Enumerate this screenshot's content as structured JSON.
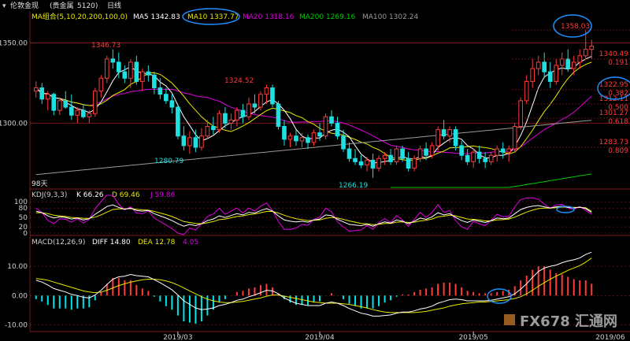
{
  "title": {
    "name": "伦敦金现",
    "category": "(贵金属",
    "code": "5120)",
    "period": "日线"
  },
  "colors": {
    "up": "#ff3b3b",
    "down": "#1ee0e0",
    "grid": "#7a1a1a",
    "ma5": "#ffffff",
    "ma10": "#e8e800",
    "ma20": "#e000e0",
    "ma200": "#00c800",
    "ma100": "#9a9a9a",
    "ann": "#1e90ff",
    "neg": "#00e5e5",
    "axis": "#d0d0d0"
  },
  "legend_main": {
    "label": "MA组合(5,10,20,200,100,0)",
    "ma5": "MA5 1342.83",
    "ma10": "MA10 1337.77",
    "ma20": "MA20 1318.16",
    "ma200": "MA200 1269.16",
    "ma100": "MA100 1302.24"
  },
  "legend_kdj": {
    "label": "KDJ(9,3,3)",
    "k": "K 66.26",
    "d": "D 69.46",
    "j": "J 59.86"
  },
  "legend_macd": {
    "label": "MACD(12,26,9)",
    "diff": "DIFF 14.80",
    "dea": "DEA 12.78",
    "macd": "4.05"
  },
  "days_label": "98天",
  "watermark": "FX678 汇通网",
  "price_labels": {
    "high1": "1346.73",
    "high2": "1324.52",
    "low1": "1280.79",
    "low2": "1266.19",
    "last_high": "1358.03"
  },
  "fib_levels": [
    {
      "price": "1340.49",
      "ratio": "0.191"
    },
    {
      "price": "1322.95",
      "ratio": "0.382"
    },
    {
      "price": "1312.11",
      "ratio": "0.500"
    },
    {
      "price": "1301.27",
      "ratio": "0.618"
    },
    {
      "price": "1283.73",
      "ratio": "0.809"
    }
  ],
  "chart_data": {
    "type": "candlestick",
    "price_axis": {
      "ticks": [
        1350.0,
        1300.0
      ],
      "ylim": [
        1260,
        1362
      ]
    },
    "kdj_axis": {
      "ticks": [
        100,
        80,
        50,
        20,
        0
      ],
      "ylim": [
        -5,
        108
      ]
    },
    "macd_axis": {
      "ticks": [
        10.0,
        0.0,
        -10.0
      ],
      "ylim": [
        -12,
        17
      ]
    },
    "x_ticks": [
      "2019/03",
      "2019/04",
      "2019/05",
      "2019/06"
    ],
    "x_tick_index": [
      24,
      48,
      74,
      111
    ],
    "candles": [
      [
        1320,
        1326,
        1316,
        1322
      ],
      [
        1322,
        1325,
        1312,
        1315
      ],
      [
        1315,
        1320,
        1308,
        1318
      ],
      [
        1318,
        1319,
        1305,
        1308
      ],
      [
        1308,
        1316,
        1305,
        1314
      ],
      [
        1314,
        1320,
        1309,
        1310
      ],
      [
        1310,
        1318,
        1302,
        1305
      ],
      [
        1305,
        1310,
        1300,
        1308
      ],
      [
        1308,
        1312,
        1303,
        1304
      ],
      [
        1304,
        1308,
        1300,
        1306
      ],
      [
        1306,
        1322,
        1304,
        1320
      ],
      [
        1320,
        1330,
        1316,
        1328
      ],
      [
        1328,
        1342,
        1325,
        1340
      ],
      [
        1340,
        1346,
        1334,
        1338
      ],
      [
        1338,
        1344,
        1328,
        1332
      ],
      [
        1332,
        1336,
        1325,
        1328
      ],
      [
        1328,
        1340,
        1322,
        1338
      ],
      [
        1338,
        1342,
        1324,
        1326
      ],
      [
        1326,
        1334,
        1320,
        1332
      ],
      [
        1332,
        1336,
        1326,
        1330
      ],
      [
        1330,
        1332,
        1318,
        1322
      ],
      [
        1322,
        1328,
        1315,
        1318
      ],
      [
        1318,
        1322,
        1312,
        1314
      ],
      [
        1314,
        1318,
        1306,
        1310
      ],
      [
        1310,
        1312,
        1290,
        1292
      ],
      [
        1292,
        1298,
        1283,
        1286
      ],
      [
        1286,
        1295,
        1281,
        1291
      ],
      [
        1291,
        1296,
        1282,
        1285
      ],
      [
        1285,
        1297,
        1283,
        1292
      ],
      [
        1292,
        1302,
        1290,
        1298
      ],
      [
        1298,
        1304,
        1293,
        1296
      ],
      [
        1296,
        1308,
        1294,
        1306
      ],
      [
        1306,
        1310,
        1297,
        1300
      ],
      [
        1300,
        1306,
        1296,
        1302
      ],
      [
        1302,
        1310,
        1298,
        1308
      ],
      [
        1308,
        1312,
        1300,
        1304
      ],
      [
        1304,
        1316,
        1302,
        1312
      ],
      [
        1312,
        1318,
        1306,
        1310
      ],
      [
        1310,
        1320,
        1308,
        1318
      ],
      [
        1318,
        1324,
        1312,
        1322
      ],
      [
        1322,
        1324,
        1310,
        1312
      ],
      [
        1312,
        1314,
        1296,
        1298
      ],
      [
        1298,
        1302,
        1286,
        1290
      ],
      [
        1290,
        1294,
        1285,
        1292
      ],
      [
        1292,
        1296,
        1286,
        1289
      ],
      [
        1289,
        1294,
        1285,
        1291
      ],
      [
        1291,
        1293,
        1284,
        1288
      ],
      [
        1288,
        1296,
        1286,
        1294
      ],
      [
        1294,
        1300,
        1289,
        1292
      ],
      [
        1292,
        1306,
        1290,
        1304
      ],
      [
        1304,
        1308,
        1298,
        1300
      ],
      [
        1300,
        1304,
        1290,
        1292
      ],
      [
        1292,
        1296,
        1282,
        1284
      ],
      [
        1284,
        1288,
        1276,
        1278
      ],
      [
        1278,
        1284,
        1274,
        1276
      ],
      [
        1276,
        1280,
        1272,
        1274
      ],
      [
        1274,
        1279,
        1270,
        1277
      ],
      [
        1277,
        1281,
        1266,
        1272
      ],
      [
        1272,
        1280,
        1270,
        1278
      ],
      [
        1278,
        1282,
        1274,
        1280
      ],
      [
        1280,
        1284,
        1274,
        1276
      ],
      [
        1276,
        1286,
        1274,
        1284
      ],
      [
        1284,
        1286,
        1276,
        1278
      ],
      [
        1278,
        1282,
        1270,
        1272
      ],
      [
        1272,
        1280,
        1270,
        1278
      ],
      [
        1278,
        1286,
        1276,
        1284
      ],
      [
        1284,
        1288,
        1277,
        1280
      ],
      [
        1280,
        1288,
        1278,
        1286
      ],
      [
        1286,
        1298,
        1283,
        1296
      ],
      [
        1296,
        1302,
        1290,
        1292
      ],
      [
        1292,
        1298,
        1288,
        1296
      ],
      [
        1296,
        1298,
        1283,
        1286
      ],
      [
        1286,
        1289,
        1277,
        1280
      ],
      [
        1280,
        1284,
        1274,
        1276
      ],
      [
        1276,
        1284,
        1272,
        1282
      ],
      [
        1282,
        1286,
        1275,
        1278
      ],
      [
        1278,
        1282,
        1272,
        1276
      ],
      [
        1276,
        1282,
        1274,
        1280
      ],
      [
        1280,
        1286,
        1276,
        1284
      ],
      [
        1284,
        1288,
        1278,
        1282
      ],
      [
        1282,
        1286,
        1276,
        1284
      ],
      [
        1284,
        1300,
        1282,
        1298
      ],
      [
        1298,
        1316,
        1296,
        1314
      ],
      [
        1314,
        1330,
        1312,
        1326
      ],
      [
        1326,
        1340,
        1322,
        1334
      ],
      [
        1334,
        1342,
        1330,
        1338
      ],
      [
        1338,
        1344,
        1328,
        1332
      ],
      [
        1332,
        1338,
        1322,
        1326
      ],
      [
        1326,
        1340,
        1324,
        1336
      ],
      [
        1336,
        1344,
        1330,
        1340
      ],
      [
        1340,
        1346,
        1332,
        1334
      ],
      [
        1334,
        1342,
        1330,
        1338
      ],
      [
        1338,
        1346,
        1334,
        1342
      ],
      [
        1342,
        1358,
        1340,
        1346
      ],
      [
        1346,
        1352,
        1340,
        1348
      ]
    ],
    "kdj": {
      "k": [
        70,
        65,
        55,
        48,
        52,
        50,
        45,
        48,
        42,
        46,
        60,
        72,
        85,
        90,
        82,
        76,
        80,
        72,
        70,
        72,
        62,
        55,
        48,
        40,
        30,
        22,
        28,
        24,
        30,
        40,
        45,
        55,
        50,
        56,
        62,
        58,
        66,
        64,
        72,
        78,
        70,
        55,
        42,
        38,
        36,
        38,
        35,
        42,
        45,
        58,
        56,
        44,
        36,
        28,
        26,
        24,
        28,
        22,
        30,
        36,
        32,
        42,
        38,
        30,
        38,
        48,
        44,
        52,
        65,
        58,
        62,
        50,
        40,
        34,
        42,
        38,
        34,
        40,
        48,
        46,
        48,
        62,
        75,
        82,
        86,
        88,
        84,
        80,
        84,
        86,
        82,
        80,
        83,
        78,
        66
      ],
      "d": [
        65,
        65,
        62,
        57,
        55,
        53,
        50,
        49,
        47,
        47,
        51,
        58,
        67,
        75,
        77,
        77,
        78,
        76,
        74,
        73,
        69,
        64,
        59,
        53,
        45,
        37,
        34,
        31,
        30,
        33,
        37,
        43,
        45,
        49,
        53,
        55,
        59,
        61,
        65,
        69,
        69,
        64,
        57,
        51,
        46,
        43,
        40,
        41,
        42,
        47,
        50,
        48,
        44,
        39,
        35,
        31,
        30,
        27,
        28,
        31,
        31,
        35,
        36,
        34,
        35,
        39,
        41,
        45,
        52,
        54,
        57,
        55,
        50,
        45,
        44,
        42,
        39,
        39,
        42,
        43,
        45,
        51,
        59,
        67,
        73,
        78,
        80,
        80,
        81,
        83,
        83,
        82,
        82,
        81,
        69.46
      ],
      "j": [
        80,
        65,
        41,
        30,
        46,
        44,
        35,
        46,
        32,
        44,
        78,
        100,
        121,
        120,
        92,
        74,
        84,
        64,
        62,
        70,
        48,
        37,
        26,
        14,
        0,
        -5,
        16,
        10,
        30,
        54,
        61,
        79,
        60,
        70,
        80,
        64,
        80,
        70,
        86,
        96,
        72,
        37,
        12,
        12,
        16,
        28,
        25,
        44,
        51,
        80,
        68,
        36,
        20,
        6,
        8,
        10,
        24,
        12,
        34,
        46,
        34,
        56,
        42,
        22,
        44,
        66,
        50,
        66,
        91,
        66,
        72,
        40,
        20,
        12,
        38,
        30,
        24,
        42,
        60,
        52,
        54,
        84,
        107,
        112,
        112,
        108,
        92,
        80,
        90,
        92,
        80,
        76,
        85,
        72,
        59.86
      ]
    },
    "macd": {
      "diff": [
        5.2,
        4.6,
        3.6,
        2.4,
        1.8,
        1.2,
        0.4,
        0.0,
        -0.6,
        -0.8,
        0.2,
        1.8,
        3.8,
        5.6,
        6.4,
        6.6,
        7.2,
        6.8,
        6.6,
        6.4,
        5.4,
        4.4,
        3.2,
        2.0,
        0.2,
        -1.8,
        -3.0,
        -4.2,
        -4.8,
        -4.6,
        -4.2,
        -3.4,
        -3.0,
        -2.4,
        -1.6,
        -1.2,
        -0.4,
        0.2,
        1.0,
        1.8,
        1.6,
        0.6,
        -0.8,
        -1.8,
        -2.6,
        -3.0,
        -3.4,
        -3.4,
        -3.4,
        -2.6,
        -2.2,
        -2.6,
        -3.4,
        -4.4,
        -5.2,
        -6.0,
        -6.4,
        -7.0,
        -7.0,
        -6.8,
        -6.6,
        -6.0,
        -5.6,
        -5.6,
        -5.2,
        -4.6,
        -4.2,
        -3.6,
        -2.6,
        -2.0,
        -1.4,
        -1.2,
        -1.4,
        -1.8,
        -1.8,
        -1.8,
        -1.8,
        -1.6,
        -1.2,
        -0.8,
        -0.4,
        0.6,
        2.2,
        4.0,
        6.2,
        8.2,
        9.4,
        10.0,
        10.4,
        11.2,
        11.8,
        12.2,
        12.8,
        14.0,
        14.8
      ],
      "dea": [
        5.8,
        5.6,
        5.2,
        4.6,
        4.0,
        3.4,
        2.8,
        2.2,
        1.6,
        1.2,
        1.0,
        1.2,
        1.8,
        2.6,
        3.4,
        4.0,
        4.6,
        5.0,
        5.4,
        5.6,
        5.6,
        5.4,
        5.0,
        4.4,
        3.6,
        2.6,
        1.6,
        0.6,
        -0.4,
        -1.2,
        -1.8,
        -2.2,
        -2.4,
        -2.4,
        -2.2,
        -2.0,
        -1.6,
        -1.2,
        -0.8,
        -0.2,
        0.2,
        0.2,
        -0.2,
        -0.6,
        -1.0,
        -1.4,
        -1.8,
        -2.2,
        -2.4,
        -2.6,
        -2.6,
        -2.6,
        -2.8,
        -3.0,
        -3.4,
        -3.8,
        -4.2,
        -4.8,
        -5.2,
        -5.6,
        -5.8,
        -5.8,
        -5.8,
        -5.8,
        -5.8,
        -5.6,
        -5.4,
        -5.0,
        -4.6,
        -4.2,
        -3.6,
        -3.2,
        -2.8,
        -2.6,
        -2.4,
        -2.2,
        -2.2,
        -2.0,
        -1.8,
        -1.6,
        -1.4,
        -1.0,
        -0.4,
        0.6,
        1.8,
        3.2,
        4.4,
        5.6,
        6.6,
        7.6,
        8.6,
        9.4,
        10.2,
        11.4,
        12.78
      ]
    }
  }
}
